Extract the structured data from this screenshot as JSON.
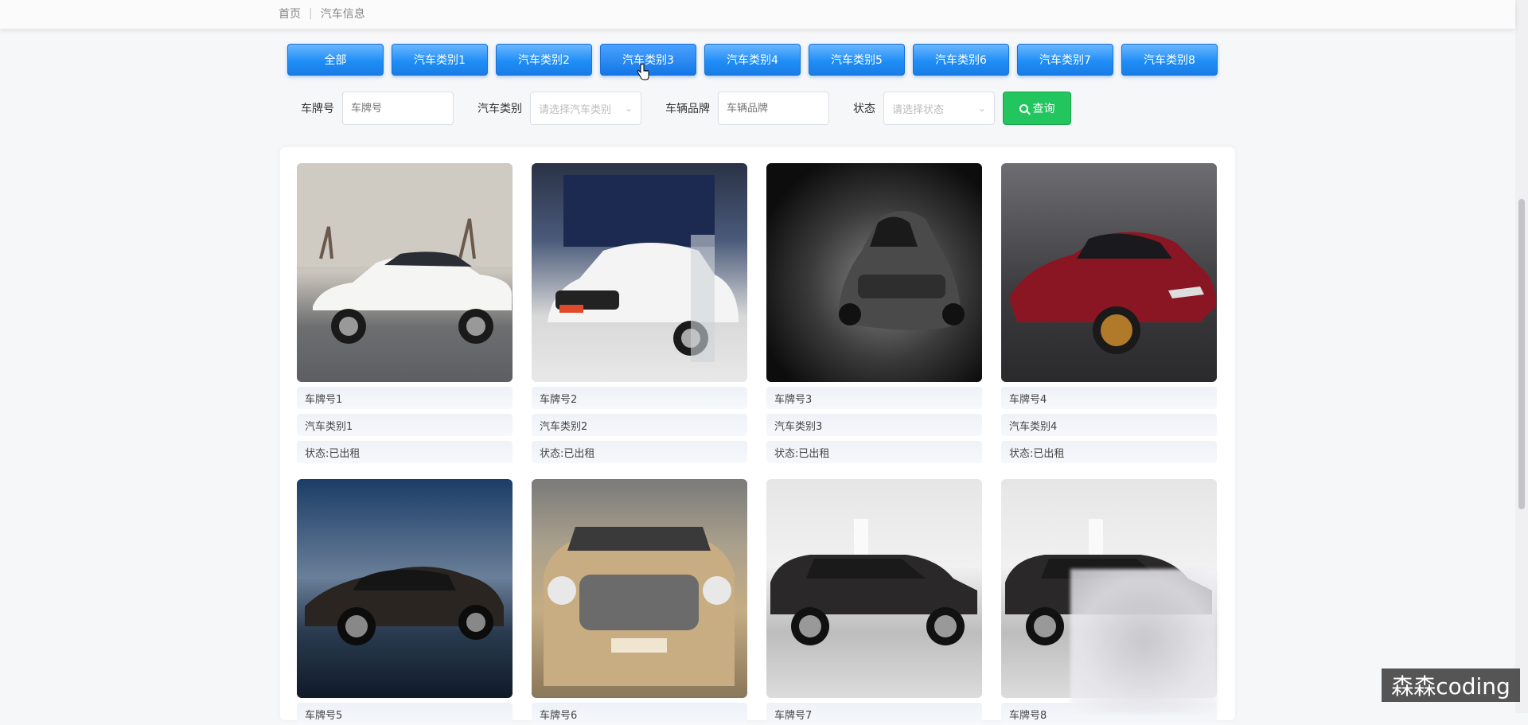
{
  "breadcrumb": {
    "home": "首页",
    "separator": "|",
    "current": "汽车信息"
  },
  "categories": [
    {
      "label": "全部"
    },
    {
      "label": "汽车类别1"
    },
    {
      "label": "汽车类别2"
    },
    {
      "label": "汽车类别3"
    },
    {
      "label": "汽车类别4"
    },
    {
      "label": "汽车类别5"
    },
    {
      "label": "汽车类别6"
    },
    {
      "label": "汽车类别7"
    },
    {
      "label": "汽车类别8"
    }
  ],
  "active_category": "汽车类别3",
  "search": {
    "plate_label": "车牌号",
    "plate_placeholder": "车牌号",
    "category_label": "汽车类别",
    "category_placeholder": "请选择汽车类别",
    "brand_label": "车辆品牌",
    "brand_placeholder": "车辆品牌",
    "status_label": "状态",
    "status_placeholder": "请选择状态",
    "button_label": "查询"
  },
  "cars": [
    {
      "plate": "车牌号1",
      "category": "汽车类别1",
      "status": "状态:已出租"
    },
    {
      "plate": "车牌号2",
      "category": "汽车类别2",
      "status": "状态:已出租"
    },
    {
      "plate": "车牌号3",
      "category": "汽车类别3",
      "status": "状态:已出租"
    },
    {
      "plate": "车牌号4",
      "category": "汽车类别4",
      "status": "状态:已出租"
    },
    {
      "plate": "车牌号5",
      "category": "",
      "status": ""
    },
    {
      "plate": "车牌号6",
      "category": "",
      "status": ""
    },
    {
      "plate": "车牌号7",
      "category": "",
      "status": ""
    },
    {
      "plate": "车牌号8",
      "category": "",
      "status": ""
    }
  ],
  "watermark": "森森coding",
  "colors": {
    "primary": "#1f8ef7",
    "search_button": "#22c55e"
  }
}
